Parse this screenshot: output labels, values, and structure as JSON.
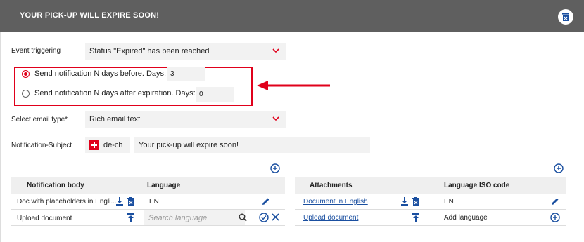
{
  "header": {
    "title": "YOUR PICK-UP WILL EXPIRE SOON!",
    "delete_icon": "trash-icon"
  },
  "event": {
    "label": "Event triggering",
    "value": "Status \"Expired\" has been reached"
  },
  "notification_timing": {
    "before_label": "Send notification N days before. Days:",
    "before_value": "3",
    "after_label": "Send notification N days after expiration. Days:",
    "after_value": "0",
    "selected": "before"
  },
  "email_type": {
    "label": "Select email type*",
    "value": "Rich email text"
  },
  "subject": {
    "label": "Notification-Subject",
    "locale": "de-ch",
    "value": "Your pick-up will expire soon!"
  },
  "body_table": {
    "headers": [
      "Notification body",
      "Language"
    ],
    "rows": [
      {
        "name": "Doc with placeholders in Engli...",
        "language": "EN"
      },
      {
        "name": "Upload document",
        "search_placeholder": "Search language"
      }
    ]
  },
  "attachments_table": {
    "headers": [
      "Attachments",
      "Language ISO code"
    ],
    "rows": [
      {
        "name": "Document in English",
        "language": "EN"
      },
      {
        "name": "Upload document",
        "language": "Add language"
      }
    ]
  },
  "colors": {
    "header_bg": "#5f5f5f",
    "accent_red": "#e0001b",
    "icon_blue": "#1a4fa0"
  }
}
